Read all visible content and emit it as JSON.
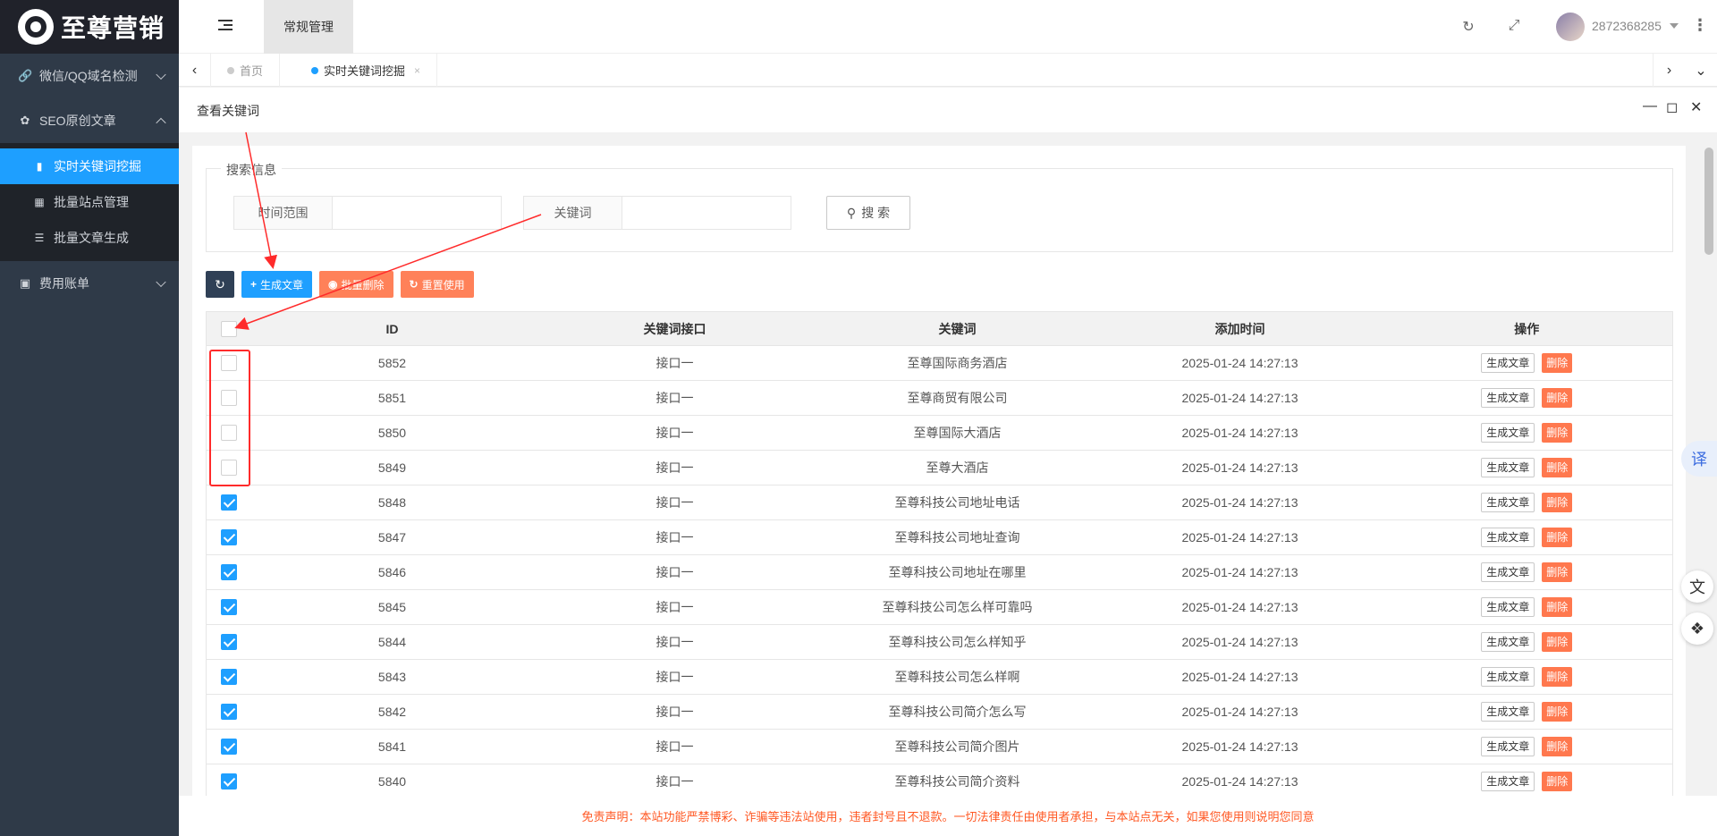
{
  "brand": {
    "name": "至尊营销"
  },
  "sidebar": {
    "groups": [
      {
        "label": "微信/QQ域名检测",
        "icon": "link-icon",
        "expanded": false
      },
      {
        "label": "SEO原创文章",
        "icon": "paw-icon",
        "expanded": true,
        "items": [
          {
            "label": "实时关键词挖掘",
            "icon": "book-icon",
            "active": true
          },
          {
            "label": "批量站点管理",
            "icon": "sitemap-icon",
            "active": false
          },
          {
            "label": "批量文章生成",
            "icon": "list-icon",
            "active": false
          }
        ]
      },
      {
        "label": "费用账单",
        "icon": "card-icon",
        "expanded": false
      }
    ]
  },
  "header": {
    "top_tab": "常规管理",
    "username": "2872368285"
  },
  "tabs": [
    {
      "label": "首页",
      "active": false
    },
    {
      "label": "实时关键词挖掘",
      "active": true,
      "close": "×"
    }
  ],
  "panel": {
    "title": "查看关键词"
  },
  "search": {
    "legend": "搜索信息",
    "time_label": "时间范围",
    "keyword_label": "关键词",
    "time_value": "",
    "keyword_value": "",
    "button": "搜 索"
  },
  "toolbar": {
    "generate": "生成文章",
    "batch_delete": "批量删除",
    "reset": "重置使用"
  },
  "table": {
    "headers": [
      "ID",
      "关键词接口",
      "关键词",
      "添加时间",
      "操作"
    ],
    "row_generate": "生成文章",
    "row_delete": "删除",
    "rows": [
      {
        "checked": false,
        "id": "5852",
        "api": "接口一",
        "keyword": "至尊国际商务酒店",
        "time": "2025-01-24 14:27:13"
      },
      {
        "checked": false,
        "id": "5851",
        "api": "接口一",
        "keyword": "至尊商贸有限公司",
        "time": "2025-01-24 14:27:13"
      },
      {
        "checked": false,
        "id": "5850",
        "api": "接口一",
        "keyword": "至尊国际大酒店",
        "time": "2025-01-24 14:27:13"
      },
      {
        "checked": false,
        "id": "5849",
        "api": "接口一",
        "keyword": "至尊大酒店",
        "time": "2025-01-24 14:27:13"
      },
      {
        "checked": true,
        "id": "5848",
        "api": "接口一",
        "keyword": "至尊科技公司地址电话",
        "time": "2025-01-24 14:27:13"
      },
      {
        "checked": true,
        "id": "5847",
        "api": "接口一",
        "keyword": "至尊科技公司地址查询",
        "time": "2025-01-24 14:27:13"
      },
      {
        "checked": true,
        "id": "5846",
        "api": "接口一",
        "keyword": "至尊科技公司地址在哪里",
        "time": "2025-01-24 14:27:13"
      },
      {
        "checked": true,
        "id": "5845",
        "api": "接口一",
        "keyword": "至尊科技公司怎么样可靠吗",
        "time": "2025-01-24 14:27:13"
      },
      {
        "checked": true,
        "id": "5844",
        "api": "接口一",
        "keyword": "至尊科技公司怎么样知乎",
        "time": "2025-01-24 14:27:13"
      },
      {
        "checked": true,
        "id": "5843",
        "api": "接口一",
        "keyword": "至尊科技公司怎么样啊",
        "time": "2025-01-24 14:27:13"
      },
      {
        "checked": true,
        "id": "5842",
        "api": "接口一",
        "keyword": "至尊科技公司简介怎么写",
        "time": "2025-01-24 14:27:13"
      },
      {
        "checked": true,
        "id": "5841",
        "api": "接口一",
        "keyword": "至尊科技公司简介图片",
        "time": "2025-01-24 14:27:13"
      },
      {
        "checked": true,
        "id": "5840",
        "api": "接口一",
        "keyword": "至尊科技公司简介资料",
        "time": "2025-01-24 14:27:13"
      }
    ]
  },
  "floating": {
    "translate": "译"
  },
  "footer": {
    "disclaimer": "免责声明：本站功能严禁博彩、诈骗等违法站使用，违者封号且不退款。一切法律责任由使用者承担，与本站点无关，如果您使用则说明您同意"
  },
  "colors": {
    "accent": "#1e9fff",
    "danger": "#ff5722",
    "sidebar": "#2f3a48",
    "annotation": "#ff2b2b"
  }
}
